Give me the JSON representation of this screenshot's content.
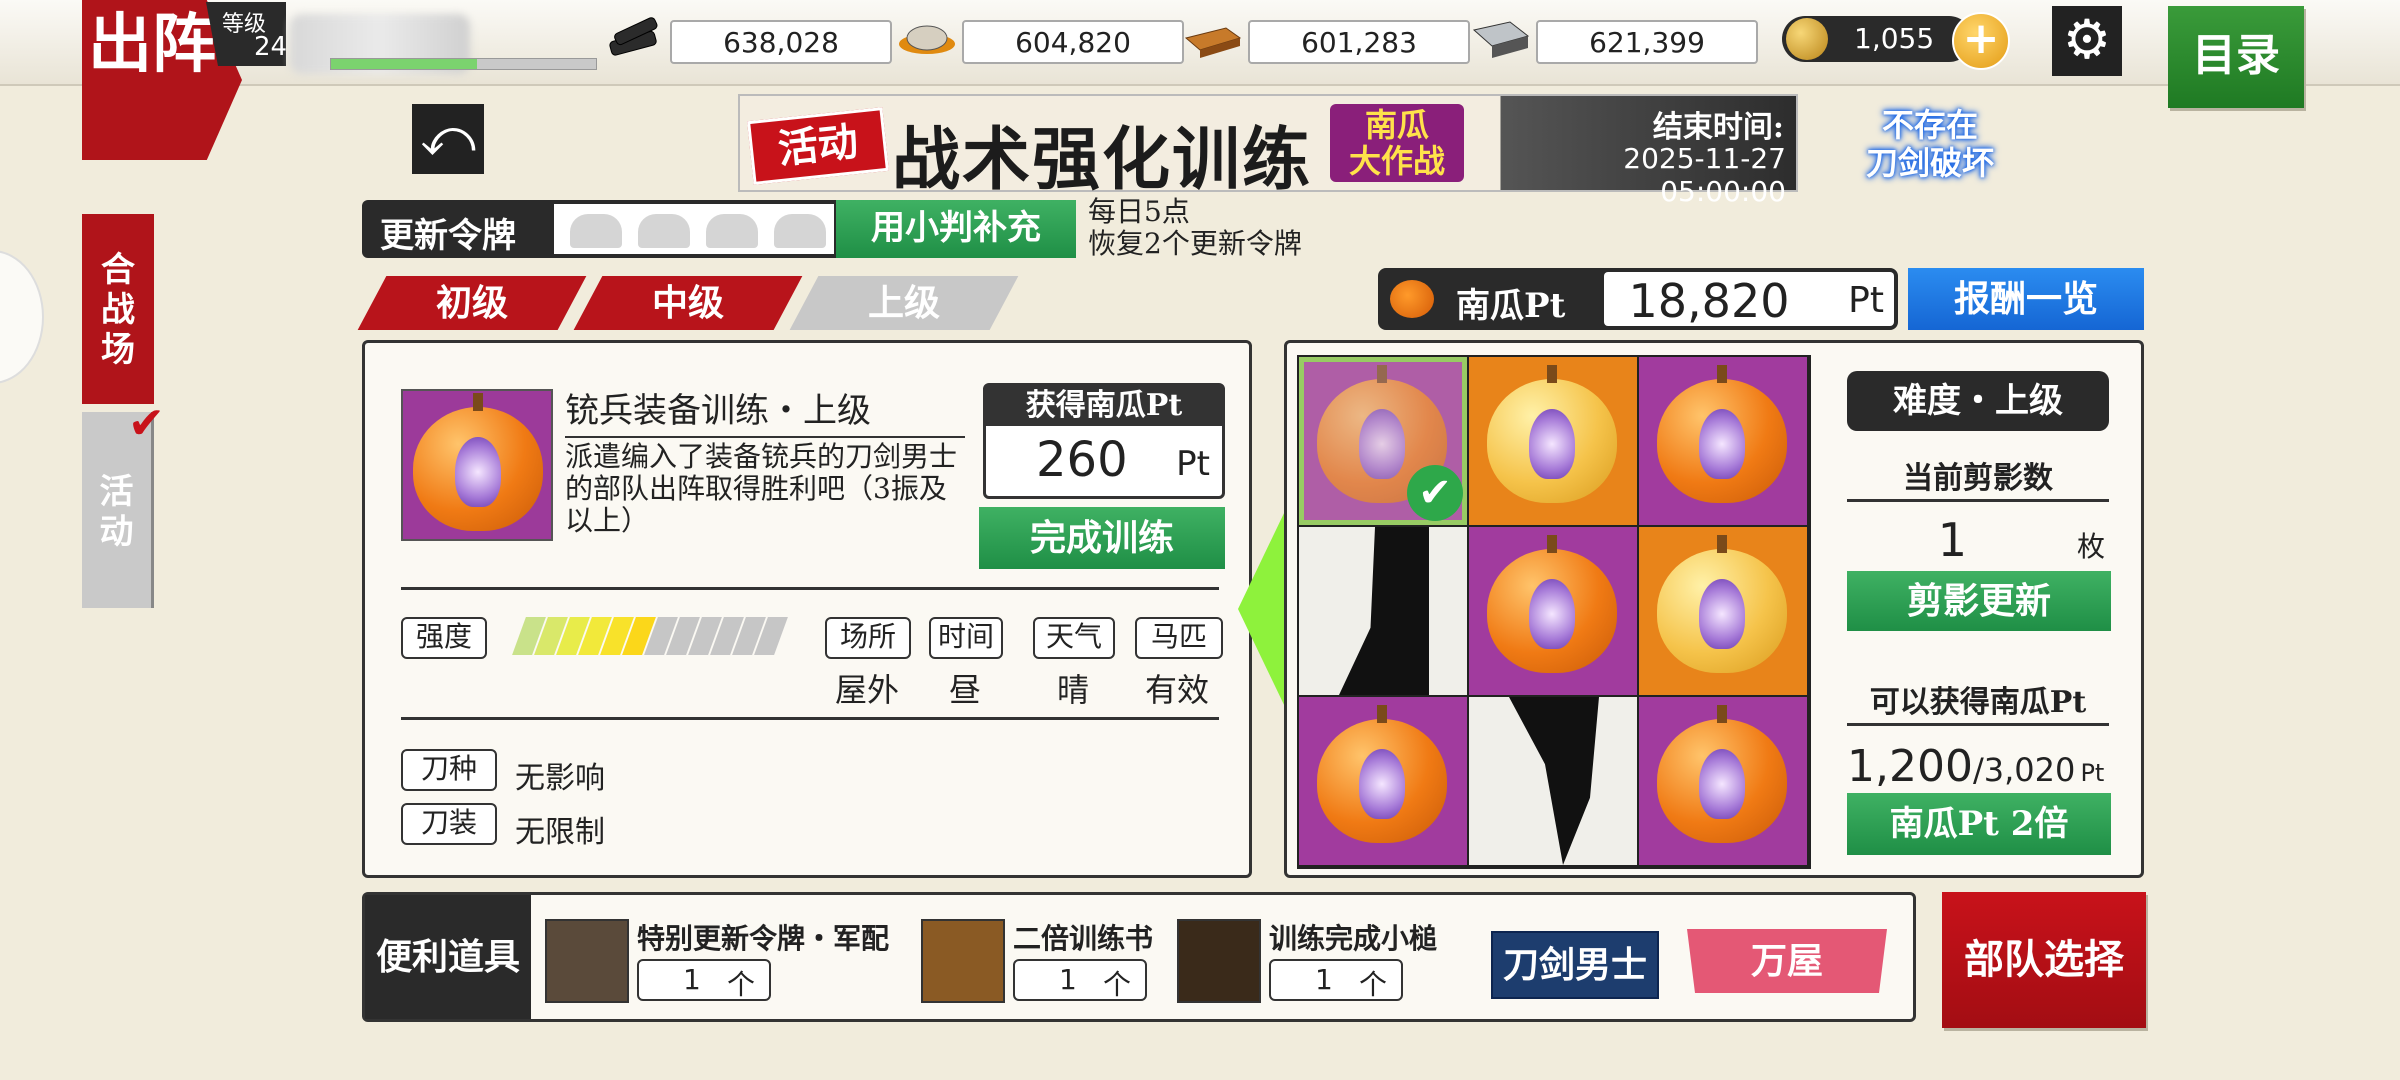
{
  "header": {
    "sortie_badge": "出阵",
    "level_label": "等级",
    "level_value": "24",
    "resources": [
      {
        "name": "charcoal",
        "icon": "charcoal-icon",
        "value": "638,028"
      },
      {
        "name": "whetstone",
        "icon": "whetstone-icon",
        "value": "604,820"
      },
      {
        "name": "cold-steel",
        "icon": "cold-steel-icon",
        "value": "601,283"
      },
      {
        "name": "tamahagane",
        "icon": "tamahagane-icon",
        "value": "621,399"
      }
    ],
    "koban": "1,055",
    "plus_glyph": "+",
    "gear_glyph": "⚙",
    "menu_button": "目录"
  },
  "side_tabs": {
    "battle": "合战场",
    "event": "活动",
    "check_glyph": "✔"
  },
  "back_glyph": "⤺",
  "banner": {
    "tag": "活动",
    "title": "战术强化训练",
    "subtitle_line1": "南瓜",
    "subtitle_line2": "大作战",
    "end_label": "结束时间:",
    "end_time": "2025-11-27 05:00:00"
  },
  "no_break_line1": "不存在",
  "no_break_line2": "刀剑破坏",
  "tokens": {
    "label": "更新令牌",
    "filled": 0,
    "total": 4,
    "refill_button": "用小判补充",
    "note_line1": "每日5点",
    "note_line2": "恢复2个更新令牌"
  },
  "grade_tabs": [
    {
      "label": "初级",
      "active": true
    },
    {
      "label": "中级",
      "active": true
    },
    {
      "label": "上级",
      "active": false
    }
  ],
  "pumpkin_pt": {
    "label": "南瓜Pt",
    "value": "18,820",
    "unit": "Pt"
  },
  "reward_button": "报酬一览",
  "mission": {
    "name": "铳兵装备训练・上级",
    "description": "派遣编入了装备铳兵的刀剑男士的部队出阵取得胜利吧（3振及以上）",
    "earn_label": "获得南瓜Pt",
    "earn_value": "260",
    "earn_unit": "Pt",
    "complete_button": "完成训练",
    "intensity_label": "强度",
    "intensity_level": 0.5,
    "conditions": [
      {
        "label": "场所",
        "value": "屋外"
      },
      {
        "label": "时间",
        "value": "昼"
      },
      {
        "label": "天气",
        "value": "晴"
      },
      {
        "label": "马匹",
        "value": "有效"
      }
    ],
    "sword_type_label": "刀种",
    "sword_type_value": "无影响",
    "equipment_label": "刀装",
    "equipment_value": "无限制"
  },
  "puzzle": {
    "cells": [
      "pumpkin-pink-checked",
      "pumpkin-gold",
      "pumpkin-pink",
      "silhouette",
      "pumpkin-pink",
      "pumpkin-gold",
      "pumpkin-pink",
      "silhouette",
      "pumpkin-pink"
    ],
    "difficulty": "难度・上级",
    "silhouette_label": "当前剪影数",
    "silhouette_count": "1",
    "silhouette_unit": "枚",
    "silhouette_button": "剪影更新",
    "obtainable_label": "可以获得南瓜Pt",
    "obtainable_current": "1,200",
    "obtainable_total": "/3,020",
    "obtainable_unit": "Pt",
    "double_button": "南瓜Pt 2倍"
  },
  "items": {
    "label": "便利道具",
    "list": [
      {
        "name": "特别更新令牌・军配",
        "count": "1",
        "unit": "个"
      },
      {
        "name": "二倍训练书",
        "count": "1",
        "unit": "个"
      },
      {
        "name": "训练完成小槌",
        "count": "1",
        "unit": "个"
      }
    ],
    "shop1": "刀剑男士",
    "shop2": "万屋"
  },
  "party_button": "部队选择"
}
